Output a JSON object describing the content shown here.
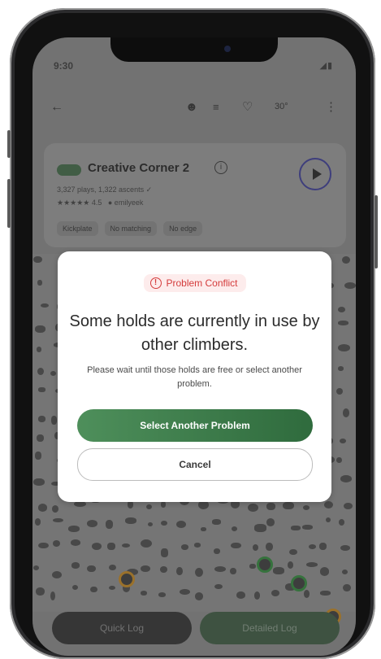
{
  "status_bar": {
    "time": "9:30",
    "signal": "◢▮"
  },
  "app_bar": {
    "grade": "30°"
  },
  "problem": {
    "title": "Creative Corner 2",
    "stats": "3,327 plays, 1,322 ascents ✓",
    "rating": "★★★★★ 4.5",
    "setter": "● emilyeek",
    "tags": [
      "Kickplate",
      "No matching",
      "No edge"
    ]
  },
  "modal": {
    "badge_label": "Problem Conflict",
    "headline": "Some holds are currently in use by other climbers.",
    "message": "Please wait until those holds are free or select another problem.",
    "primary_button": "Select Another Problem",
    "cancel_button": "Cancel"
  },
  "bottom_actions": {
    "quick_log": "Quick Log",
    "detailed_log": "Detailed Log"
  },
  "colors": {
    "accent_green": "#3f7d4b",
    "warning_red": "#d43c3c",
    "ring_green": "#2f8a3a",
    "ring_orange": "#c8891e"
  }
}
